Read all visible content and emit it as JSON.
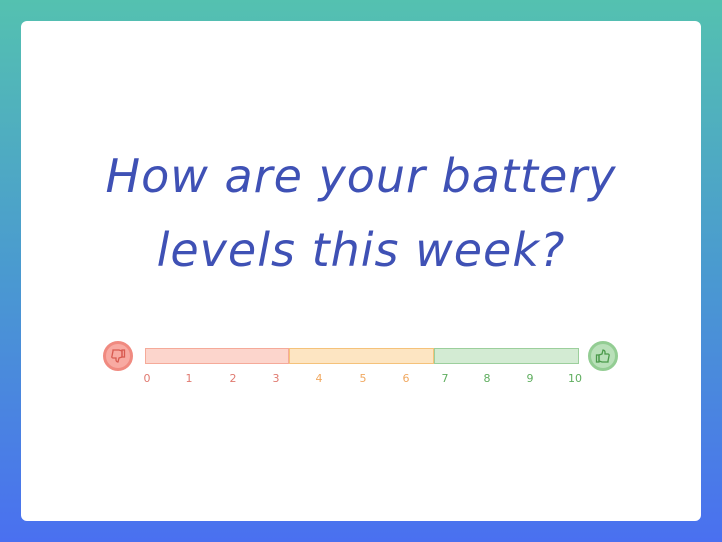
{
  "question": {
    "line1": "How are your battery",
    "line2": "levels this week?"
  },
  "scale": {
    "min": 0,
    "max": 10,
    "ticks": [
      "0",
      "1",
      "2",
      "3",
      "4",
      "5",
      "6",
      "7",
      "8",
      "9",
      "10"
    ],
    "low_icon": "thumbs-down-icon",
    "high_icon": "thumbs-up-icon",
    "colors": {
      "low": "#f08a80",
      "mid": "#f5c27a",
      "high": "#93cd93",
      "text": "#3f51b5"
    }
  }
}
